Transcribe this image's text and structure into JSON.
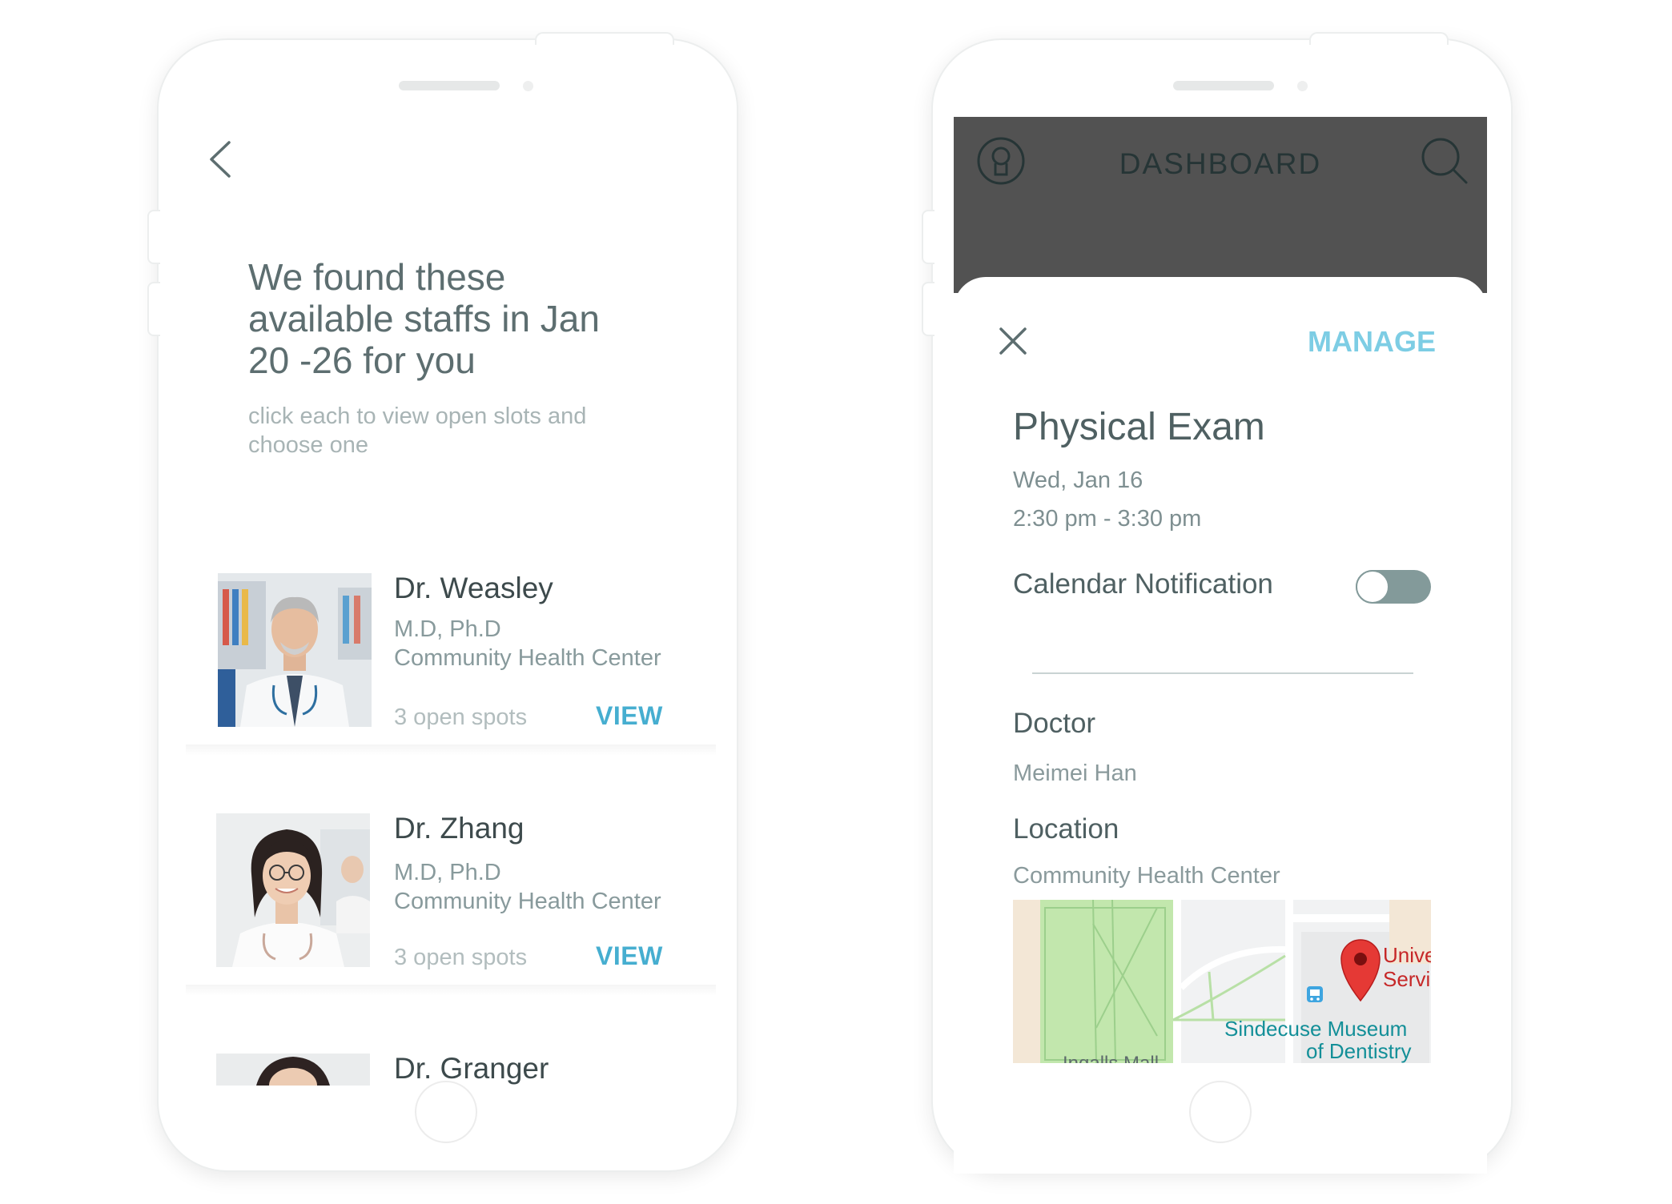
{
  "left_screen": {
    "headline": "We found these available staffs in Jan 20 -26 for you",
    "subline": "click each to view open slots and choose one",
    "doctors": [
      {
        "name": "Dr. Weasley",
        "credentials": "M.D, Ph.D",
        "center": "Community Health Center",
        "spots": "3 open spots",
        "action": "VIEW"
      },
      {
        "name": "Dr. Zhang",
        "credentials": "M.D, Ph.D",
        "center": "Community Health Center",
        "spots": "3 open spots",
        "action": "VIEW"
      },
      {
        "name": "Dr. Granger"
      }
    ]
  },
  "right_screen": {
    "header_title": "DASHBOARD",
    "manage_label": "MANAGE",
    "event": {
      "title": "Physical Exam",
      "date": "Wed, Jan 16",
      "time": "2:30 pm - 3:30 pm"
    },
    "notification": {
      "label": "Calendar Notification",
      "enabled": false
    },
    "doctor": {
      "label": "Doctor",
      "value": "Meimei Han"
    },
    "location": {
      "label": "Location",
      "value": "Community Health Center"
    },
    "map": {
      "labels": [
        "Unive",
        "Servi",
        "Sindecuse Museum",
        "of Dentistry",
        "Ingalls Mall"
      ]
    }
  },
  "colors": {
    "accent_view": "#46aed0",
    "accent_manage": "#7dcde4",
    "header_bg": "#525252",
    "toggle": "#839a9a",
    "map_park": "#bfe3a7",
    "map_pin": "#e53935"
  },
  "icons": [
    "back-chevron-icon",
    "profile-icon",
    "search-icon",
    "close-icon",
    "map-pin-icon",
    "bus-stop-icon"
  ]
}
